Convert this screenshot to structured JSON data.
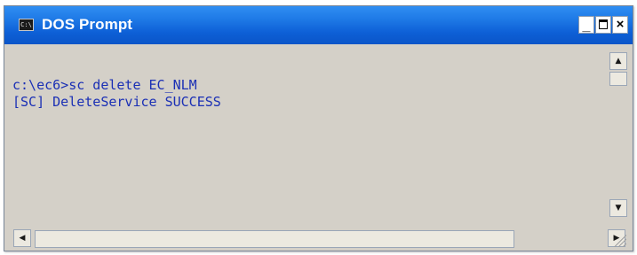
{
  "window": {
    "title": "DOS Prompt",
    "icon": "console-app-icon",
    "icon_glyph": "C:\\",
    "controls": {
      "minimize": "_",
      "close": "×"
    }
  },
  "console": {
    "lines": [
      "c:\\ec6>sc delete EC_NLM",
      "[SC] DeleteService SUCCESS"
    ]
  },
  "scrollbars": {
    "up_glyph": "▲",
    "down_glyph": "▼",
    "left_glyph": "◀",
    "right_glyph": "▶"
  },
  "colors": {
    "titlebar": "#0d5fd6",
    "console_bg": "#d4d0c8",
    "console_text": "#1a2fb5"
  }
}
